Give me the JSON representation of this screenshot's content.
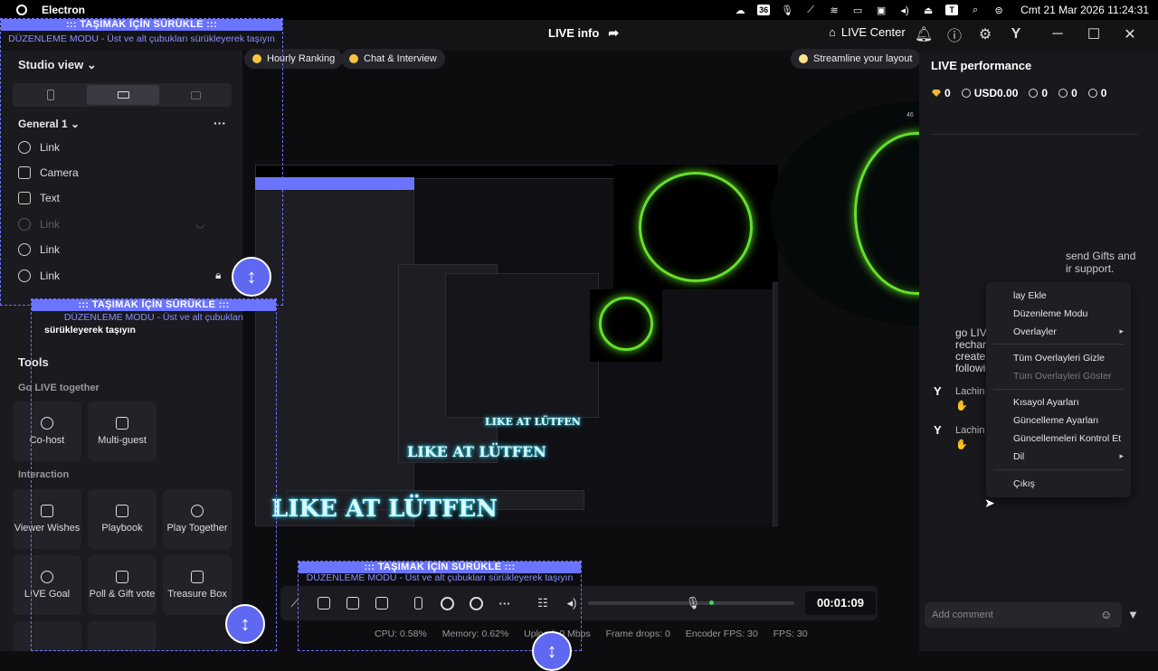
{
  "os_bar": {
    "app_name": "Electron",
    "tray_badge_1": "36",
    "tray_badge_2": "T",
    "clock": "Cmt 21 Mar 2026 11:24:31"
  },
  "header": {
    "title": "LIVE info",
    "live_center": "LIVE Center"
  },
  "sidebar": {
    "studio_view": "Studio view",
    "group_label": "General 1",
    "sources": [
      {
        "label": "Link",
        "icon": "globe-icon"
      },
      {
        "label": "Camera",
        "icon": "camera-icon"
      },
      {
        "label": "Text",
        "icon": "text-icon"
      },
      {
        "label": "Link",
        "icon": "globe-icon"
      },
      {
        "label": "Link",
        "icon": "globe-icon"
      },
      {
        "label": "Link",
        "icon": "globe-icon"
      }
    ],
    "tools_title": "Tools",
    "go_live_together": "Go LIVE together",
    "interaction": "Interaction",
    "tools": {
      "co_host": "Co-host",
      "multi_guest": "Multi-guest",
      "viewer_wishes": "Viewer Wishes",
      "playbook": "Playbook",
      "play_together": "Play Together",
      "live_goal": "LIVE Goal",
      "poll_gift": "Poll & Gift vote",
      "treasure_box": "Treasure Box"
    }
  },
  "overlay": {
    "drag_title": "::: TAŞIMAK İÇİN SÜRÜKLE :::",
    "drag_sub": "DÜZENLEME MODU - Üst ve alt çubukları sürükleyerek taşıyın",
    "drag_sub_short": "DÜZENLEME MODU - Üst ve alt çubukları",
    "drag_sub_tail": "sürükleyerek taşıyın",
    "handle_glyph": "↕"
  },
  "stage": {
    "pill_ranking": "Hourly Ranking",
    "pill_chat": "Chat & Interview",
    "pill_streamline": "Streamline your layout",
    "like_text": "LIKE AT LÜTFEN",
    "circle_number": "46"
  },
  "controls": {
    "timer": "00:01:09",
    "stats": {
      "cpu": "CPU: 0.58%",
      "memory": "Memory: 0.62%",
      "upload": "Upload: 0 Mbps",
      "frame_drops": "Frame drops: 0",
      "encoder_fps": "Encoder FPS: 30",
      "fps": "FPS: 30"
    }
  },
  "right_panel": {
    "title": "LIVE performance",
    "gems": "0",
    "usd": "USD0.00",
    "viewers": "0",
    "follows": "0",
    "likes": "0",
    "send_gifts": "send Gifts and",
    "support": "ir support.",
    "go_live_1": "go LIV",
    "go_live_2": "recharg",
    "go_live_3": "create",
    "go_live_4": "followi",
    "chat_user_1": "Lachin",
    "chat_user_2": "Lachin",
    "comment_placeholder": "Add comment"
  },
  "context_menu": {
    "items": [
      {
        "label": "lay Ekle",
        "disabled": false
      },
      {
        "label": "Düzenleme Modu",
        "disabled": false
      },
      {
        "label": "Overlayler",
        "disabled": false,
        "submenu": true
      },
      {
        "label": "Tüm Overlayleri Gizle",
        "disabled": false
      },
      {
        "label": "Tüm Overlayleri Göster",
        "disabled": true
      },
      {
        "label": "Kısayol Ayarları",
        "disabled": false
      },
      {
        "label": "Güncelleme Ayarları",
        "disabled": false
      },
      {
        "label": "Güncellemeleri Kontrol Et",
        "disabled": false
      },
      {
        "label": "Dil",
        "disabled": false,
        "submenu": true
      },
      {
        "label": "Çıkış",
        "disabled": false
      }
    ]
  }
}
